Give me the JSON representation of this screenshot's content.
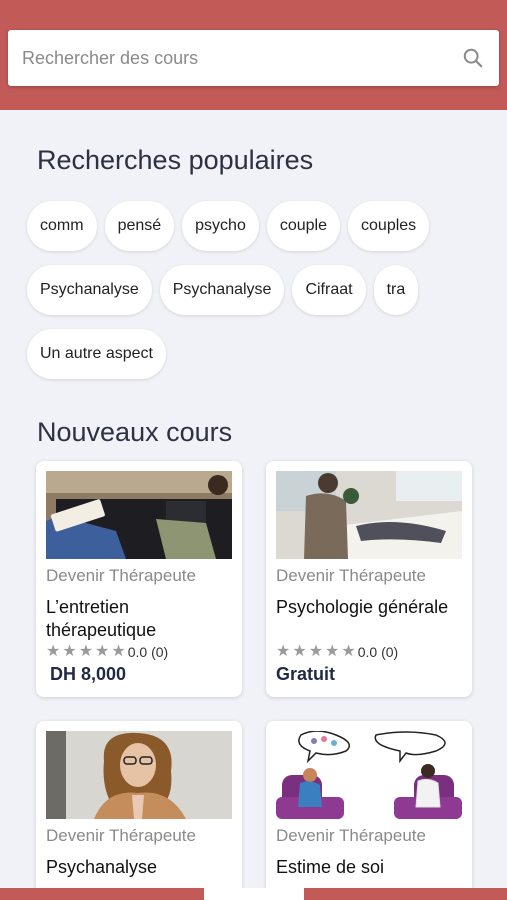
{
  "search": {
    "placeholder": "Rechercher des cours"
  },
  "popular": {
    "title": "Recherches populaires",
    "chips": [
      "comm",
      "pensé",
      "psycho",
      "couple",
      "couples",
      "Psychanalyse",
      "Psychanalyse",
      "Cifraat",
      "tra",
      "Un autre aspect"
    ]
  },
  "new_courses": {
    "title": "Nouveaux cours",
    "cards": [
      {
        "category": "Devenir Thérapeute",
        "title": "L’entretien thérapeutique",
        "rating": "0.0 (0)",
        "stars": 0,
        "price": "DH 8,000"
      },
      {
        "category": "Devenir Thérapeute",
        "title": "Psychologie générale",
        "rating": "0.0 (0)",
        "stars": 0,
        "price": "Gratuit"
      },
      {
        "category": "Devenir Thérapeute",
        "title": "Psychanalyse"
      },
      {
        "category": "Devenir Thérapeute",
        "title": "Estime de soi"
      }
    ]
  },
  "colors": {
    "header": "#c25a58",
    "background": "#f1f2f7",
    "heading": "#2d3142",
    "price": "#1f2a44"
  },
  "icons": [
    "search-icon",
    "star-icon"
  ]
}
